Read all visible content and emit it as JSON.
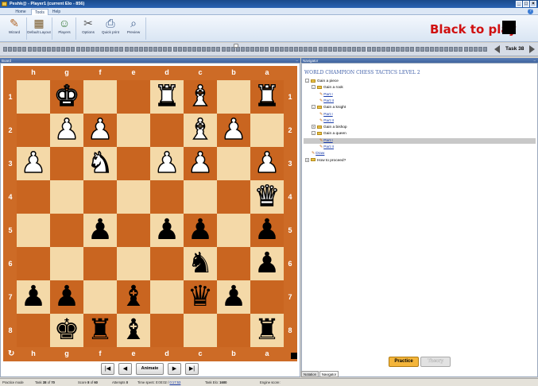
{
  "window": {
    "title": "Peshk@ - Player1 (current Elo - 856)"
  },
  "ribbon_tabs": [
    "Home",
    "Tools",
    "Help"
  ],
  "toolbar": [
    {
      "label": "Wizard",
      "icon": "wizard-icon",
      "glyph": "✎"
    },
    {
      "label": "Default Layout",
      "icon": "layout-icon",
      "glyph": "▦"
    },
    {
      "label": "Players",
      "icon": "players-icon",
      "glyph": "☺"
    },
    {
      "label": "Options",
      "icon": "options-icon",
      "glyph": "✂"
    },
    {
      "label": "Quick print",
      "icon": "print-icon",
      "glyph": "⎙"
    },
    {
      "label": "Preview",
      "icon": "preview-icon",
      "glyph": "⌕"
    }
  ],
  "turn": {
    "text": "Black to play",
    "color": "#d01010"
  },
  "task_nav": {
    "label": "Task 38"
  },
  "board_panel": {
    "title": "Board",
    "files": [
      "h",
      "g",
      "f",
      "e",
      "d",
      "c",
      "b",
      "a"
    ],
    "ranks": [
      "1",
      "2",
      "3",
      "4",
      "5",
      "6",
      "7",
      "8"
    ]
  },
  "board_position": [
    [
      "",
      "wK",
      "",
      "",
      "wR",
      "wB",
      "",
      "wR"
    ],
    [
      "",
      "wP",
      "wP",
      "",
      "",
      "wB",
      "wP",
      ""
    ],
    [
      "wP",
      "",
      "wN",
      "",
      "wP",
      "wP",
      "",
      "wP"
    ],
    [
      "",
      "",
      "",
      "",
      "",
      "",
      "",
      "wQ"
    ],
    [
      "",
      "",
      "bP",
      "",
      "bP",
      "bP",
      "",
      "bP"
    ],
    [
      "",
      "",
      "",
      "",
      "",
      "bN",
      "",
      "bP"
    ],
    [
      "bP",
      "bP",
      "",
      "bB",
      "",
      "bQ",
      "bP",
      ""
    ],
    [
      "",
      "bK",
      "bR",
      "bB",
      "",
      "",
      "",
      "bR"
    ]
  ],
  "board_nav": {
    "animate_label": "Animate"
  },
  "navigator": {
    "header": "Navigator",
    "title": "WORLD CHAMPION CHESS TACTICS LEVEL 2",
    "tree": [
      {
        "label": "Gain a piece",
        "type": "folder",
        "expand": "-"
      },
      {
        "label": "Gain a rook",
        "type": "folder",
        "expand": "-"
      },
      {
        "label": "Part I",
        "type": "link"
      },
      {
        "label": "Part II",
        "type": "link"
      },
      {
        "label": "Gain a knight",
        "type": "folder",
        "expand": "-"
      },
      {
        "label": "Part I",
        "type": "link"
      },
      {
        "label": "Part II",
        "type": "link"
      },
      {
        "label": "Gain a bishop",
        "type": "folder",
        "expand": "+"
      },
      {
        "label": "Gain a queen",
        "type": "folder",
        "expand": "-"
      },
      {
        "label": "Part I",
        "type": "link",
        "selected": true
      },
      {
        "label": "Part II",
        "type": "link"
      },
      {
        "label": "Draw",
        "type": "link"
      },
      {
        "label": "How to proceed?",
        "type": "folder",
        "expand": "+"
      }
    ],
    "buttons": {
      "practice": "Practice",
      "theory": "Theory"
    },
    "tabs": [
      "Notation",
      "Navigator"
    ]
  },
  "status": {
    "mode": "Practice mode",
    "task_prefix": "Task",
    "task_value": "38",
    "task_of": "of",
    "task_total": "70",
    "score_prefix": "Score",
    "score_value": "8",
    "score_of": "of",
    "score_total": "60",
    "attempts_prefix": "Attempts",
    "attempts_value": "0",
    "time_prefix": "Time spent:",
    "time_value": "0:00:02",
    "time_sep": "/",
    "time_link": "0:17:53",
    "elo_prefix": "Task Elo:",
    "elo_value": "1600",
    "engine": "Engine score:"
  },
  "colors": {
    "accent": "#d01010",
    "board_light": "#f4d9a8",
    "board_dark": "#c96520",
    "link": "#1a3caa",
    "practice_bg": "#f4b53a"
  }
}
